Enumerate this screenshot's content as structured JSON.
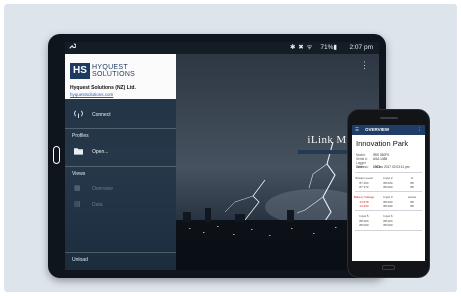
{
  "colors": {
    "background": "#dde4ec",
    "tablet_body": "#0e151c",
    "drawer": "#1e3244",
    "app_bar": "#1f3d66",
    "alert_red": "#d11f1f"
  },
  "tablet": {
    "status_bar": {
      "sys_icons": "✱ ✖ ᯤ",
      "battery": "71%▮",
      "time": "2:07 pm"
    },
    "brand_title": "iLink Mobile",
    "drawer": {
      "logo_mark": "HS",
      "logo_line1": "HYQUEST",
      "logo_line2": "SOLUTIONS",
      "company": "Hyquest Solutions (NZ) Ltd.",
      "website": "hyquestsolutions.com",
      "items": {
        "connect": {
          "icon": "antenna-icon",
          "label": "Connect"
        },
        "profiles": "Profiles",
        "open": {
          "icon": "folder-icon",
          "label": "Open..."
        },
        "views": "Views",
        "overview": "Overview",
        "data": "Data",
        "unload": "Unload"
      }
    }
  },
  "phone": {
    "app_bar_title": "OVERVIEW",
    "site": "Innovation Park",
    "meta": [
      {
        "k": "Model:",
        "v": "iRIS 350FS"
      },
      {
        "k": "Serial #:",
        "v": "ASA 1485"
      },
      {
        "k": "Logger Time:",
        "v": "19 Dec 2017 02:03:11 pm"
      },
      {
        "k": "Address:",
        "v": "1363"
      }
    ],
    "rows": [
      [
        "Stream Level",
        "Input 2",
        "In"
      ],
      [
        "87.163",
        "88.024",
        "88"
      ],
      [
        "87.172",
        "88.000",
        "88"
      ],
      [
        "Battery Voltage",
        "Input 3",
        "series"
      ],
      [
        "13.678",
        "88.024",
        "88"
      ],
      [
        "13.400",
        "88.000",
        "88"
      ],
      [
        "Input 5",
        "Input 6",
        ""
      ],
      [
        "88.024",
        "88.024",
        ""
      ],
      [
        "88.000",
        "88.000",
        ""
      ]
    ]
  }
}
